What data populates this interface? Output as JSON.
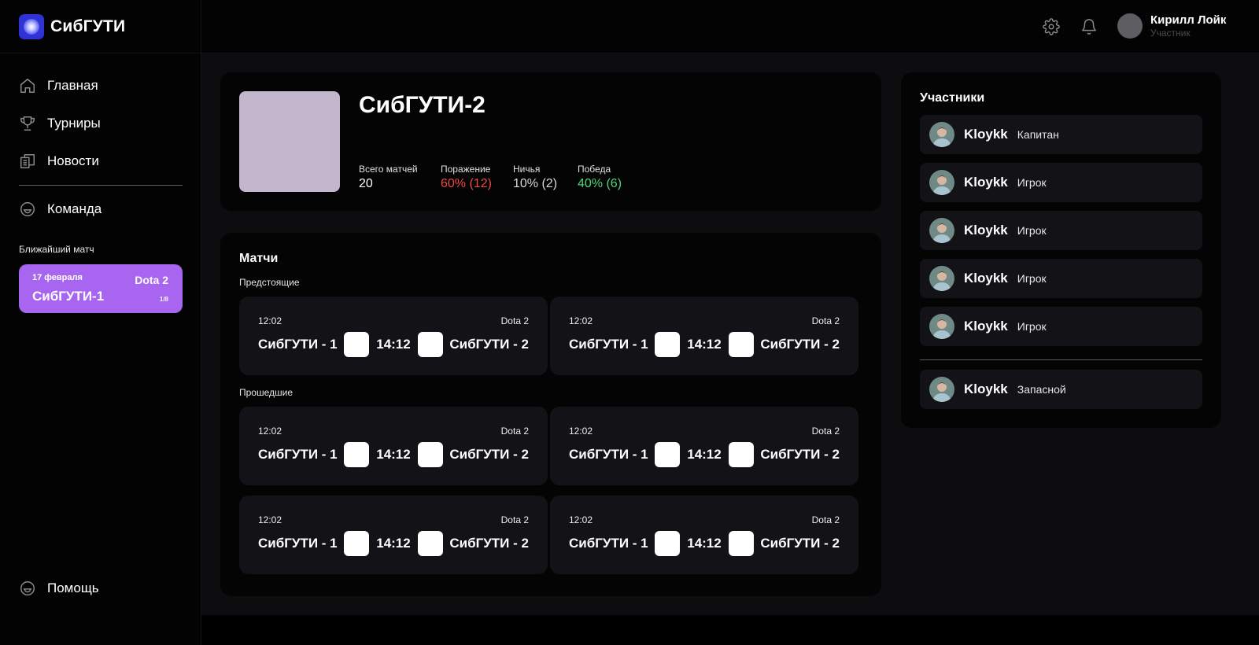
{
  "brand": {
    "name": "СибГУТИ",
    "logo_icon": "sibguti-logo-icon"
  },
  "header": {
    "icons": [
      "settings-gear-icon",
      "notification-bell-icon"
    ],
    "user": {
      "name": "Кирилл Лойк",
      "role": "Участник"
    }
  },
  "sidebar": {
    "items": [
      {
        "label": "Главная",
        "icon": "home-icon"
      },
      {
        "label": "Турниры",
        "icon": "trophy-icon"
      },
      {
        "label": "Новости",
        "icon": "news-icon"
      },
      {
        "label": "Команда",
        "icon": "team-icon"
      }
    ],
    "next_match": {
      "label": "Ближайший матч",
      "date": "17 февраля",
      "game": "Dota 2",
      "team": "СибГУТИ-1",
      "stage": "1/8"
    },
    "help": {
      "label": "Помощь",
      "icon": "help-icon"
    }
  },
  "team": {
    "name": "СибГУТИ-2",
    "stats": [
      {
        "label": "Всего матчей",
        "value": "20",
        "color": "#ffffff"
      },
      {
        "label": "Поражение",
        "value": "60% (12)",
        "color": "#f04848"
      },
      {
        "label": "Ничья",
        "value": "10% (2)",
        "color": "#d9d9dc"
      },
      {
        "label": "Победа",
        "value": "40% (6)",
        "color": "#4fd77a"
      }
    ]
  },
  "matches": {
    "title": "Матчи",
    "upcoming_label": "Предстоящие",
    "past_label": "Прошедшие",
    "upcoming": [
      {
        "time": "12:02",
        "game": "Dota 2",
        "team1": "СибГУТИ - 1",
        "score": "14:12",
        "team2": "СибГУТИ - 2"
      },
      {
        "time": "12:02",
        "game": "Dota 2",
        "team1": "СибГУТИ - 1",
        "score": "14:12",
        "team2": "СибГУТИ - 2"
      }
    ],
    "past": [
      {
        "time": "12:02",
        "game": "Dota 2",
        "team1": "СибГУТИ - 1",
        "score": "14:12",
        "team2": "СибГУТИ - 2"
      },
      {
        "time": "12:02",
        "game": "Dota 2",
        "team1": "СибГУТИ - 1",
        "score": "14:12",
        "team2": "СибГУТИ - 2"
      },
      {
        "time": "12:02",
        "game": "Dota 2",
        "team1": "СибГУТИ - 1",
        "score": "14:12",
        "team2": "СибГУТИ - 2"
      },
      {
        "time": "12:02",
        "game": "Dota 2",
        "team1": "СибГУТИ - 1",
        "score": "14:12",
        "team2": "СибГУТИ - 2"
      }
    ]
  },
  "members": {
    "title": "Участники",
    "main": [
      {
        "nick": "Kloykk",
        "role": "Капитан"
      },
      {
        "nick": "Kloykk",
        "role": "Игрок"
      },
      {
        "nick": "Kloykk",
        "role": "Игрок"
      },
      {
        "nick": "Kloykk",
        "role": "Игрок"
      },
      {
        "nick": "Kloykk",
        "role": "Игрок"
      }
    ],
    "reserve": [
      {
        "nick": "Kloykk",
        "role": "Запасной"
      }
    ]
  }
}
